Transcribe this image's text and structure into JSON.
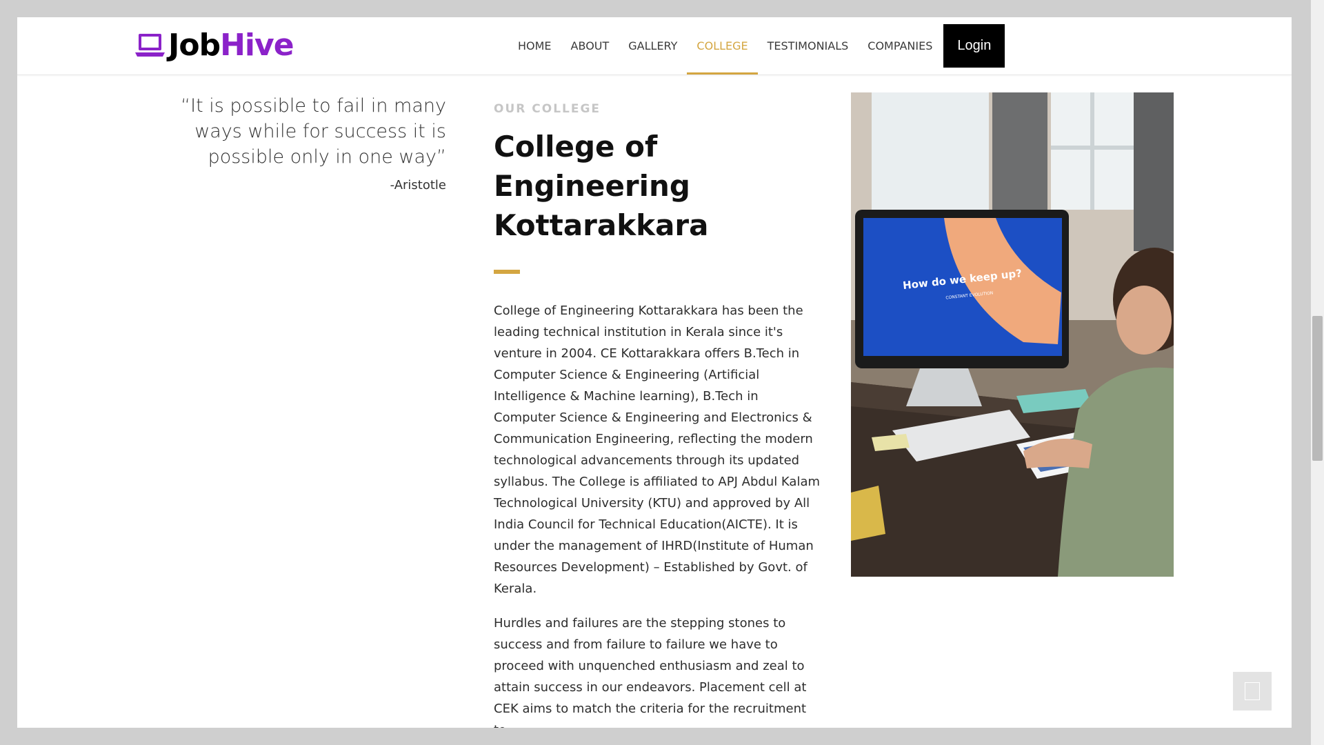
{
  "brand": {
    "job": "Job",
    "hive": "Hive",
    "icon": "laptop-icon"
  },
  "nav": {
    "items": [
      {
        "label": "HOME",
        "active": false
      },
      {
        "label": "ABOUT",
        "active": false
      },
      {
        "label": "GALLERY",
        "active": false
      },
      {
        "label": "COLLEGE",
        "active": true
      },
      {
        "label": "TESTIMONIALS",
        "active": false
      },
      {
        "label": "COMPANIES",
        "active": false
      }
    ],
    "login_label": "Login"
  },
  "quote": {
    "text": "“It is possible to fail in many ways while for success it is possible only in one way”",
    "author": "-Aristotle"
  },
  "college": {
    "eyebrow": "OUR COLLEGE",
    "title": "College of Engineering Kottarakkara",
    "paragraphs": [
      "College of Engineering Kottarakkara has been the leading technical institution in Kerala since it's venture in 2004. CE Kottarakkara offers B.Tech in Computer Science & Engineering (Artificial Intelligence & Machine learning), B.Tech in Computer Science & Engineering and Electronics & Communication Engineering, reflecting the modern technological advancements through its updated syllabus. The College is affiliated to APJ Abdul Kalam Technological University (KTU) and approved by All India Council for Technical Education(AICTE). It is under the management of IHRD(Institute of Human Resources Development) – Established by Govt. of Kerala.",
      "Hurdles and failures are the stepping stones to success and from failure to failure we have to proceed with unquenched enthusiasm and zeal to attain success in our endeavors. Placement cell at CEK aims to match the criteria for the recruitment to"
    ]
  },
  "photo": {
    "screen_text": "How do we keep up?",
    "screen_subtext": "CONSTANT EVOLUTION"
  },
  "colors": {
    "accent": "#d4a641",
    "brand_purple": "#8b22c9"
  },
  "scroll_top_icon": "arrow-up-icon"
}
